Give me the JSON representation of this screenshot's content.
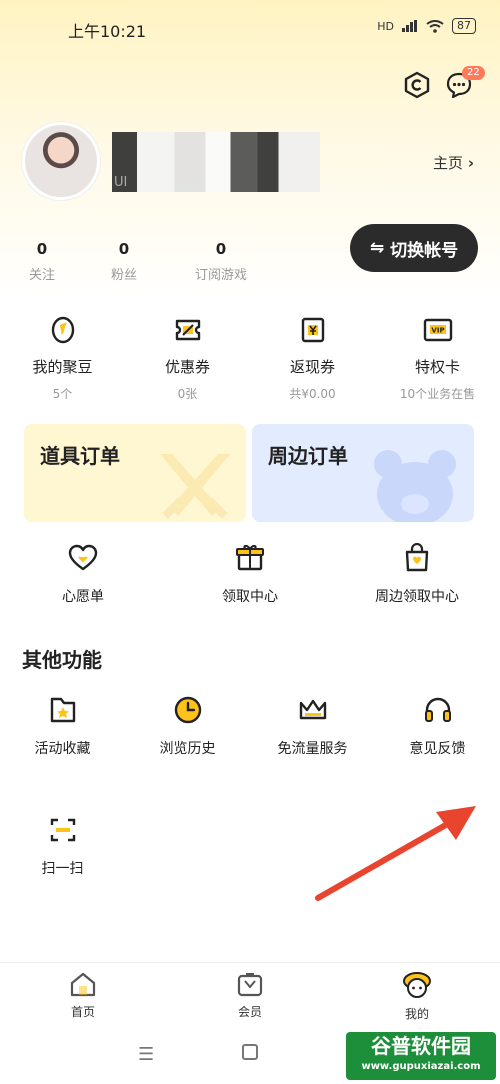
{
  "status_bar": {
    "time": "上午10:21",
    "network": "HD",
    "battery": "87"
  },
  "header": {
    "message_badge": "22"
  },
  "profile": {
    "uid_prefix": "UI",
    "homepage_label": "主页"
  },
  "stats": [
    {
      "value": "0",
      "label": "关注"
    },
    {
      "value": "0",
      "label": "粉丝"
    },
    {
      "value": "0",
      "label": "订阅游戏"
    }
  ],
  "switch_account_label": "切换帐号",
  "wallet": [
    {
      "label": "我的聚豆",
      "sub": "5个",
      "icon": "bean-icon"
    },
    {
      "label": "优惠券",
      "sub": "0张",
      "icon": "coupon-icon"
    },
    {
      "label": "返现券",
      "sub": "共¥0.00",
      "icon": "cashback-icon"
    },
    {
      "label": "特权卡",
      "sub": "10个业务在售",
      "icon": "vip-card-icon"
    }
  ],
  "orders": {
    "props_order": "道具订单",
    "merch_order": "周边订单"
  },
  "services": [
    {
      "label": "心愿单",
      "icon": "heart-icon"
    },
    {
      "label": "领取中心",
      "icon": "gift-icon"
    },
    {
      "label": "周边领取中心",
      "icon": "bag-icon"
    }
  ],
  "other_section_title": "其他功能",
  "other_features": [
    {
      "label": "活动收藏",
      "icon": "folder-star-icon"
    },
    {
      "label": "浏览历史",
      "icon": "clock-icon"
    },
    {
      "label": "免流量服务",
      "icon": "crown-icon"
    },
    {
      "label": "意见反馈",
      "icon": "headset-icon"
    }
  ],
  "scan": {
    "label": "扫一扫",
    "icon": "scan-icon"
  },
  "bottom_nav": [
    {
      "label": "首页",
      "icon": "home-icon"
    },
    {
      "label": "会员",
      "icon": "member-icon"
    },
    {
      "label": "我的",
      "icon": "mine-icon"
    }
  ],
  "watermark": {
    "text": "谷普软件园",
    "url": "www.gupuxiazai.com"
  },
  "colors": {
    "accent": "#ffc21a",
    "dark_button": "#2b2b2b",
    "annotation_arrow": "#e8442e"
  }
}
